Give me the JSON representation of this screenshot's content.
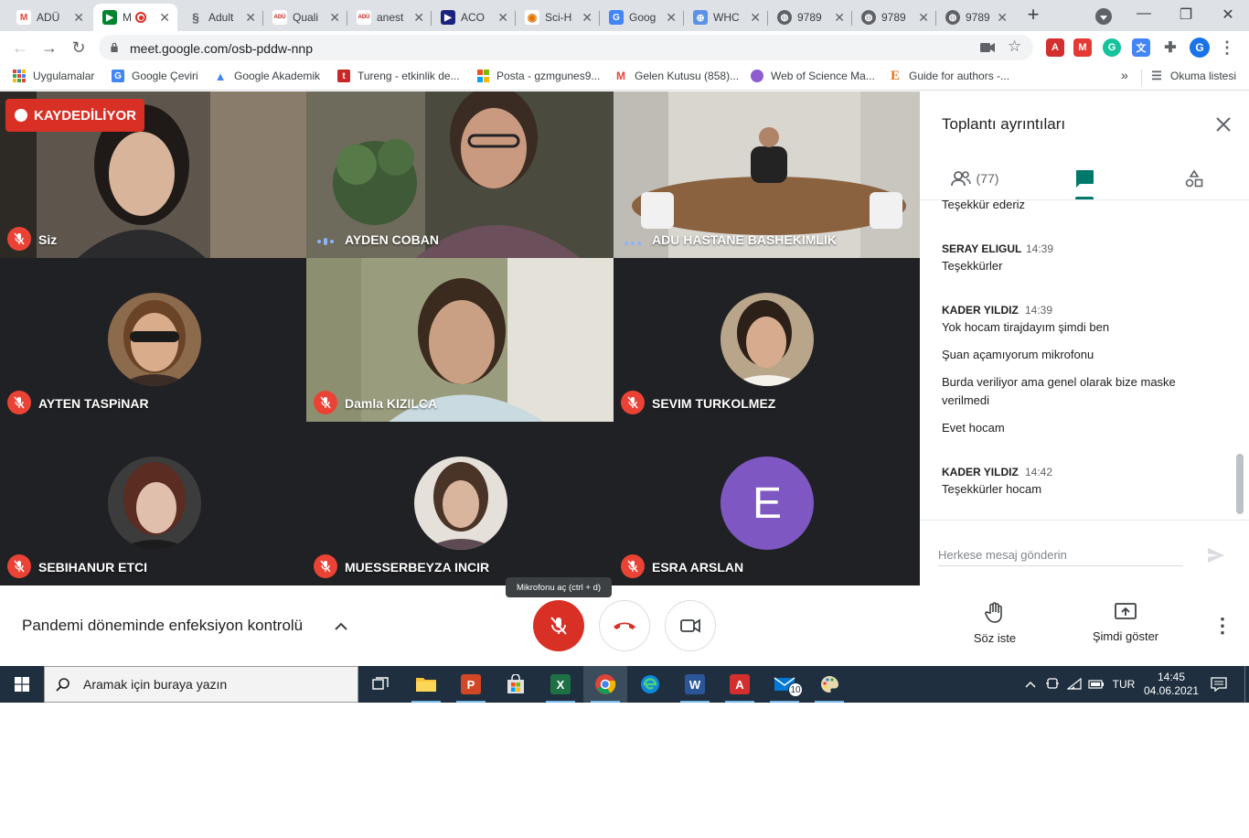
{
  "browser": {
    "tabs": [
      {
        "label": "ADÜ",
        "icon": "gmail-icon",
        "color": "#ea4335"
      },
      {
        "label": "M",
        "icon": "meet-icon",
        "color": "#00832d",
        "active": true
      },
      {
        "label": "Adult",
        "icon": "link-icon",
        "color": "#5f6368"
      },
      {
        "label": "Quali",
        "icon": "ados-icon",
        "color": "#c5221f"
      },
      {
        "label": "anest",
        "icon": "ados-icon",
        "color": "#c5221f"
      },
      {
        "label": "ACO",
        "icon": "aco-icon",
        "color": "#1a237e"
      },
      {
        "label": "Sci-H",
        "icon": "scihub-icon",
        "color": "#e37400"
      },
      {
        "label": "Goog",
        "icon": "google-translate-icon",
        "color": "#4285f4"
      },
      {
        "label": "WHC",
        "icon": "who-icon",
        "color": "#5b92e5"
      },
      {
        "label": "9789",
        "icon": "globe-icon",
        "color": "#5f6368"
      },
      {
        "label": "9789",
        "icon": "globe-icon",
        "color": "#5f6368"
      },
      {
        "label": "9789",
        "icon": "globe-icon",
        "color": "#5f6368"
      }
    ],
    "url": "meet.google.com/osb-pddw-nnp",
    "profile_initial": "G",
    "bookmarks": [
      {
        "label": "Uygulamalar",
        "icon": "apps-grid-icon"
      },
      {
        "label": "Google Çeviri",
        "icon": "google-translate-icon"
      },
      {
        "label": "Google Akademik",
        "icon": "scholar-icon"
      },
      {
        "label": "Tureng - etkinlik de...",
        "icon": "tureng-icon"
      },
      {
        "label": "Posta - gzmgunes9...",
        "icon": "outlook-icon"
      },
      {
        "label": "Gelen Kutusu (858)...",
        "icon": "gmail-icon"
      },
      {
        "label": "Web of Science Ma...",
        "icon": "wos-icon"
      },
      {
        "label": "Guide for authors -...",
        "icon": "elsevier-icon"
      }
    ],
    "reading_list": "Okuma listesi",
    "more_bookmarks": "»"
  },
  "meet": {
    "recording_label": "KAYDEDİLİYOR",
    "participants": [
      {
        "name": "Siz",
        "muted": true
      },
      {
        "name": "AYDEN COBAN",
        "muted": false,
        "speaking": true
      },
      {
        "name": "ADU HASTANE BASHEKIMLIK",
        "muted": false,
        "speaking": true
      },
      {
        "name": "AYTEN TASPiNAR",
        "muted": true
      },
      {
        "name": "Damla KIZILCA",
        "muted": true
      },
      {
        "name": "SEVIM TURKOLMEZ",
        "muted": true
      },
      {
        "name": "SEBIHANUR ETCI",
        "muted": true
      },
      {
        "name": "MUESSERBEYZA INCIR",
        "muted": true
      },
      {
        "name": "ESRA ARSLAN",
        "muted": true,
        "initial": "E",
        "avatar_color": "#7e57c2"
      }
    ],
    "panel": {
      "title": "Toplantı ayrıntıları",
      "people_count": "(77)",
      "messages": [
        {
          "sender": "",
          "time": "",
          "lines": [
            "Teşekkür ederiz"
          ]
        },
        {
          "sender": "SERAY ELIGUL",
          "time": "14:39",
          "lines": [
            "Teşekkürler"
          ]
        },
        {
          "sender": "KADER YILDIZ",
          "time": "14:39",
          "lines": [
            "Yok hocam tirajdayım şimdi ben",
            "Şuan açamıyorum mikrofonu",
            "Burda veriliyor ama genel olarak bize maske verilmedi",
            "Evet hocam"
          ]
        },
        {
          "sender": "KADER YILDIZ",
          "time": "14:42",
          "lines": [
            "Teşekkürler hocam"
          ]
        }
      ],
      "compose_placeholder": "Herkese mesaj gönderin"
    },
    "controls": {
      "meeting_title": "Pandemi döneminde enfeksiyon kontrolü",
      "mic_tooltip": "Mikrofonu aç (ctrl + d)",
      "raise_hand": "Söz iste",
      "present_now": "Şimdi göster"
    }
  },
  "taskbar": {
    "search_placeholder": "Aramak için buraya yazın",
    "lang": "TUR",
    "time": "14:45",
    "date": "04.06.2021",
    "mail_badge": "10"
  },
  "colors": {
    "accent_green": "#00796b",
    "danger_red": "#d93025",
    "meet_bg": "#202124"
  }
}
